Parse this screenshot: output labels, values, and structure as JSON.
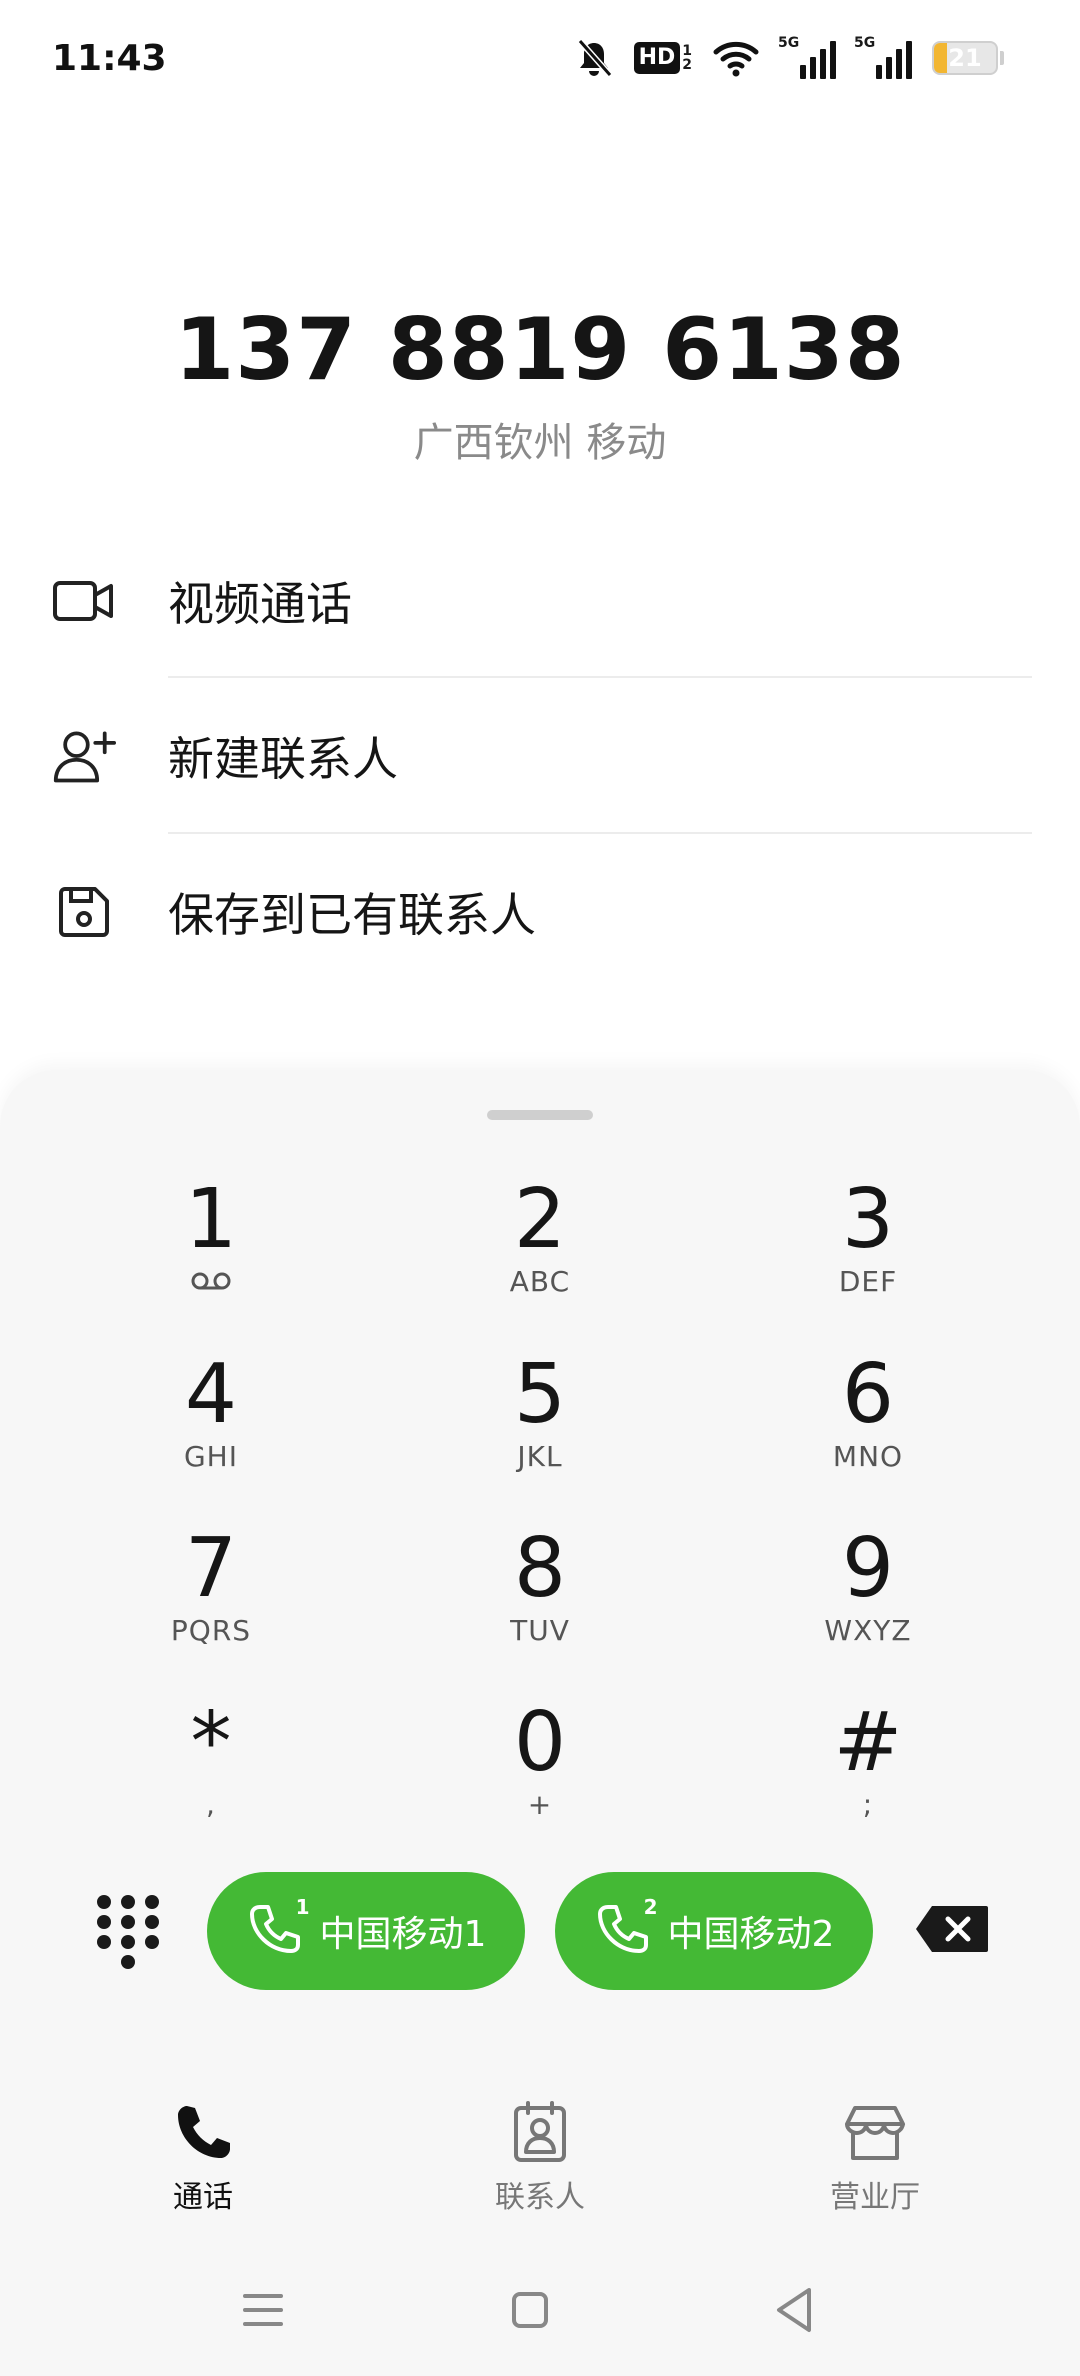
{
  "status_bar": {
    "time": "11:43",
    "hd_label": "HD",
    "hd_sub_top": "1",
    "hd_sub_bottom": "2",
    "sim1_net": "5G",
    "sim2_net": "5G",
    "battery_level": "21",
    "battery_fill": 0.21,
    "battery_color": "#f2b632"
  },
  "number": {
    "value": "137 8819 6138",
    "location": "广西钦州 移动"
  },
  "options": [
    {
      "label": "视频通话",
      "icon": "video-camera-icon"
    },
    {
      "label": "新建联系人",
      "icon": "add-person-icon"
    },
    {
      "label": "保存到已有联系人",
      "icon": "save-icon"
    }
  ],
  "keypad": [
    {
      "digit": "1",
      "letters": ""
    },
    {
      "digit": "2",
      "letters": "ABC"
    },
    {
      "digit": "3",
      "letters": "DEF"
    },
    {
      "digit": "4",
      "letters": "GHI"
    },
    {
      "digit": "5",
      "letters": "JKL"
    },
    {
      "digit": "6",
      "letters": "MNO"
    },
    {
      "digit": "7",
      "letters": "PQRS"
    },
    {
      "digit": "8",
      "letters": "TUV"
    },
    {
      "digit": "9",
      "letters": "WXYZ"
    },
    {
      "digit": "*",
      "letters": ","
    },
    {
      "digit": "0",
      "letters": "+"
    },
    {
      "digit": "#",
      "letters": ";"
    }
  ],
  "call_buttons": [
    {
      "label": "中国移动1",
      "sim": "1"
    },
    {
      "label": "中国移动2",
      "sim": "2"
    }
  ],
  "accent_color": "#44b935",
  "bottom_nav": [
    {
      "label": "通话",
      "icon": "phone-icon",
      "active": true
    },
    {
      "label": "联系人",
      "icon": "contacts-icon",
      "active": false
    },
    {
      "label": "营业厅",
      "icon": "store-icon",
      "active": false
    }
  ]
}
